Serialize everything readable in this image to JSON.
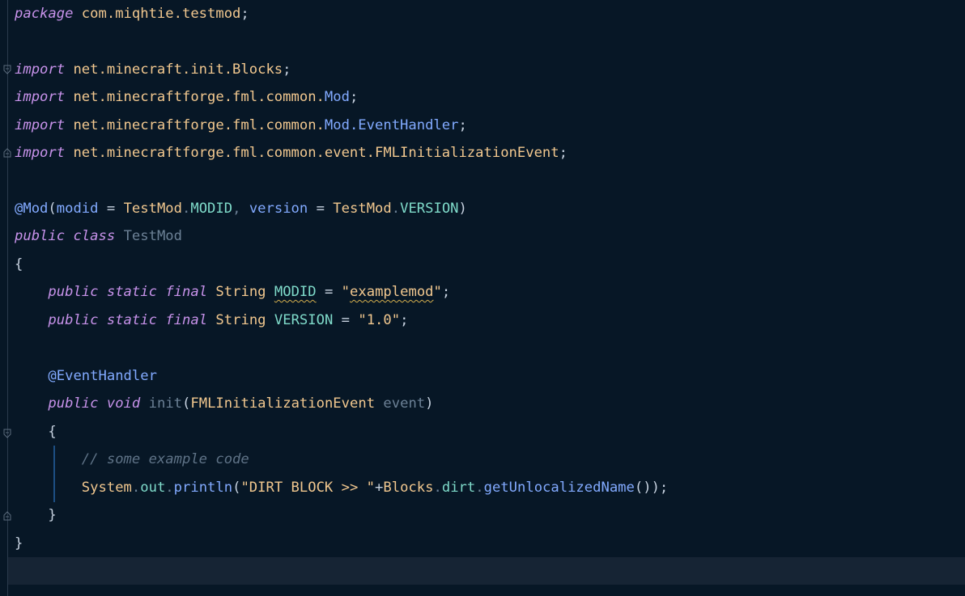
{
  "code": {
    "l1_kw": "package",
    "l1_name": "com.miqhtie.testmod",
    "l1_semi": ";",
    "import_kw": "import",
    "imp1_path": "net.minecraft.init.Blocks",
    "imp2_path": "net.minecraftforge.fml.common.",
    "imp2_cls": "Mod",
    "imp3_path": "net.minecraftforge.fml.common.",
    "imp3_cls": "Mod",
    "imp3_dot": ".",
    "imp3_cls2": "EventHandler",
    "imp4_path": "net.minecraftforge.fml.common.event.FMLInitializationEvent",
    "semi": ";",
    "ann_mod": "@Mod",
    "paren_open": "(",
    "paren_close": ")",
    "arg_modid": "modid",
    "eq": " = ",
    "testmod": "TestMod",
    "dot": ".",
    "modid_const": "MODID",
    "comma": ", ",
    "arg_version": "version",
    "version_const": "VERSION",
    "public_kw": "public",
    "class_kw": "class",
    "class_name": "TestMod",
    "brace_open": "{",
    "brace_close": "}",
    "static_kw": "static",
    "final_kw": "final",
    "string_type": "String",
    "modid_value": "\"examplemod\"",
    "quote": "\"",
    "modid_value_inner": "examplemod",
    "version_value": "\"1.0\"",
    "ann_event": "@EventHandler",
    "void_kw": "void",
    "method_name": "init",
    "param_type": "FMLInitializationEvent",
    "param_name": "event",
    "comment": "// some example code",
    "system": "System",
    "out": "out",
    "println": "println",
    "print_str": "\"DIRT BLOCK >> \"",
    "plus": "+",
    "blocks": "Blocks",
    "dirt": "dirt",
    "get_name": "getUnlocalizedName",
    "call_end": "());"
  },
  "colors": {
    "background": "#071726",
    "keyword": "#c792ea",
    "type": "#f2c88f",
    "field": "#7fdbca",
    "function": "#82aaff",
    "comment": "#5f7387"
  }
}
